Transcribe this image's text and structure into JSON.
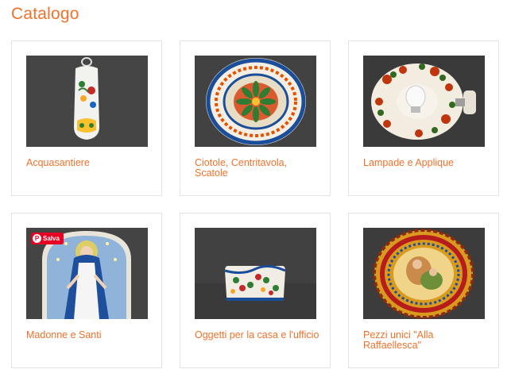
{
  "page": {
    "title": "Catalogo"
  },
  "pinterest": {
    "save_label": "Salva",
    "glyph": "P"
  },
  "cards": [
    {
      "label": "Acquasantiere"
    },
    {
      "label": "Ciotole, Centritavola, Scatole"
    },
    {
      "label": "Lampade e Applique"
    },
    {
      "label": "Madonne e Santi"
    },
    {
      "label": "Oggetti per la casa e l'ufficio"
    },
    {
      "label": "Pezzi unici \"Alla Raffaellesca\""
    }
  ],
  "colors": {
    "accent": "#f0722c",
    "pinterest_red": "#e60023",
    "card_border": "#e3e3e3"
  }
}
